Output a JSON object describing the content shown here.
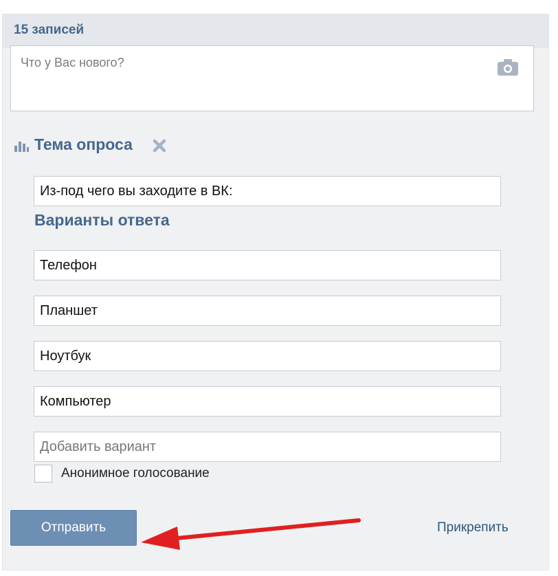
{
  "header": {
    "title": "15 записей"
  },
  "status": {
    "placeholder": "Что у Вас нового?",
    "attach_photo_icon": "camera-icon"
  },
  "poll": {
    "icon": "bar-chart-icon",
    "title": "Тема опроса",
    "remove_icon": "close-x-icon",
    "question_value": "Из-под чего вы заходите в ВК:",
    "options_title": "Варианты ответа",
    "options": [
      {
        "value": "Телефон"
      },
      {
        "value": "Планшет"
      },
      {
        "value": "Ноутбук"
      },
      {
        "value": "Компьютер"
      }
    ],
    "add_option_placeholder": "Добавить вариант",
    "anonymous_label": "Анонимное голосование"
  },
  "footer": {
    "send_label": "Отправить",
    "attach_label": "Прикрепить"
  },
  "annotation": {
    "arrow_color": "#e02020"
  },
  "colors": {
    "accent": "#45688e",
    "button": "#6d8fb3",
    "link": "#2b587a"
  }
}
